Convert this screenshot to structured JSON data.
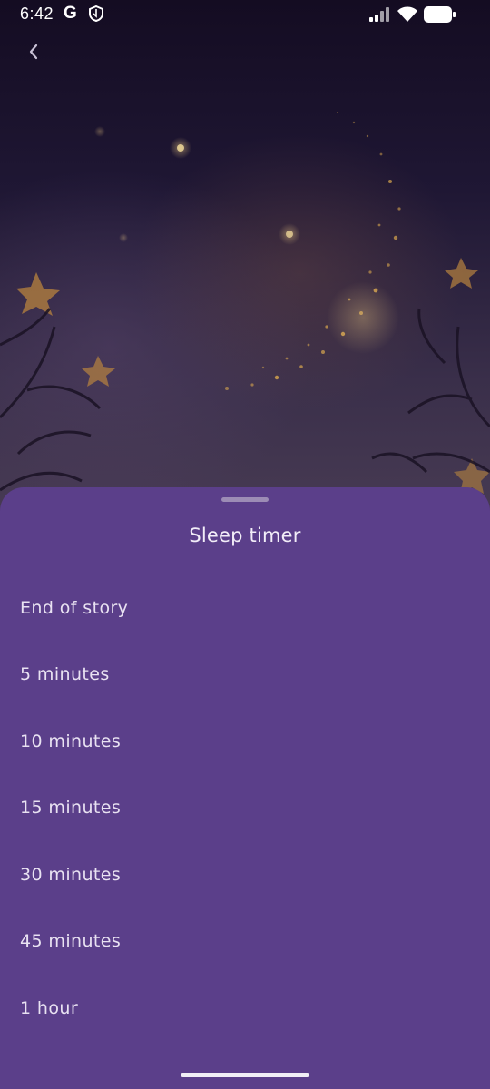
{
  "status_bar": {
    "time": "6:42",
    "g_label": "G",
    "icons": [
      "shield-icon",
      "signal-icon",
      "wifi-icon",
      "battery-icon"
    ]
  },
  "nav": {
    "back_icon": "chevron-left-icon"
  },
  "sheet": {
    "title": "Sleep timer",
    "options": [
      {
        "label": "End of story"
      },
      {
        "label": "5 minutes"
      },
      {
        "label": "10 minutes"
      },
      {
        "label": "15 minutes"
      },
      {
        "label": "30 minutes"
      },
      {
        "label": "45 minutes"
      },
      {
        "label": "1 hour"
      }
    ]
  },
  "colors": {
    "sheet_background": "#5b3f8a",
    "sheet_text": "#e9e2f2",
    "handle": "#9c8cb5",
    "sky_dark": "#140c22",
    "star_glow": "#d9a74e"
  }
}
